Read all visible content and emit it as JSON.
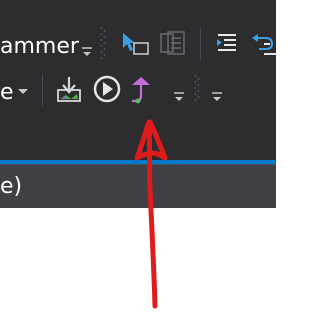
{
  "toolbar": {
    "row1_label": "ammer",
    "row2_label": "e"
  },
  "status": {
    "text": "e)"
  },
  "icons": {
    "row1": [
      "dropdown-arrow-icon",
      "select-pointer-icon",
      "copy-pages-icon",
      "align-right-icon",
      "wrap-text-icon"
    ],
    "row2": [
      "dropdown-arrow-icon",
      "save-download-icon",
      "play-circle-icon",
      "step-out-icon",
      "dropdown-arrow-icon",
      "dropdown-arrow-icon"
    ]
  },
  "colors": {
    "toolbar_bg": "#2d2d30",
    "accent": "#007acc",
    "status_bg": "#3f3f46",
    "annotation": "#e01b1b"
  }
}
